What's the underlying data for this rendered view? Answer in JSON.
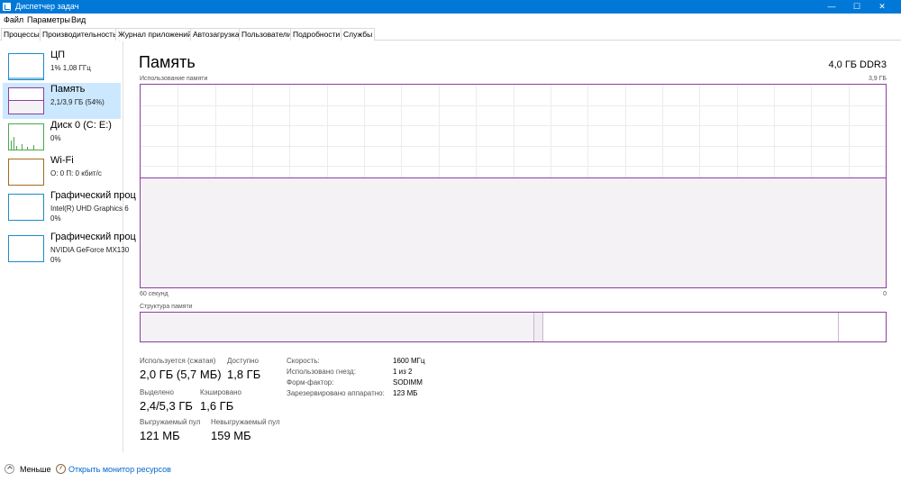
{
  "window": {
    "title": "Диспетчер задач",
    "min_glyph": "—",
    "max_glyph": "☐",
    "close_glyph": "✕"
  },
  "menu": [
    "Файл",
    "Параметры",
    "Вид"
  ],
  "tabs": [
    {
      "label": "Процессы",
      "active": false
    },
    {
      "label": "Производительность",
      "active": true
    },
    {
      "label": "Журнал приложений",
      "active": false
    },
    {
      "label": "Автозагрузка",
      "active": false
    },
    {
      "label": "Пользователи",
      "active": false
    },
    {
      "label": "Подробности",
      "active": false
    },
    {
      "label": "Службы",
      "active": false
    }
  ],
  "sidebar": {
    "items": [
      {
        "title": "ЦП",
        "lines": [
          "1%  1,08 ГГц"
        ],
        "active": false,
        "color": "#1e8cc8"
      },
      {
        "title": "Память",
        "lines": [
          "2,1/3,9 ГБ (54%)"
        ],
        "active": true,
        "color": "#8b3fa0"
      },
      {
        "title": "Диск 0 (C: E:)",
        "lines": [
          "0%"
        ],
        "active": false,
        "color": "#4ca64c"
      },
      {
        "title": "Wi-Fi",
        "lines": [
          "О: 0 П: 0 кбит/с"
        ],
        "active": false,
        "color": "#a66a1e"
      },
      {
        "title": "Графический проц",
        "lines": [
          "Intel(R) UHD Graphics 6",
          "0%"
        ],
        "active": false,
        "color": "#1e8cc8"
      },
      {
        "title": "Графический проц",
        "lines": [
          "NVIDIA GeForce MX130",
          "0%"
        ],
        "active": false,
        "color": "#1e8cc8"
      }
    ]
  },
  "memory": {
    "title": "Память",
    "spec": "4,0 ГБ DDR3",
    "graph": {
      "label": "Использование памяти",
      "max_label": "3,9 ГБ",
      "time_label": "60 секунд",
      "zero_label": "0",
      "usage_fraction": 0.54
    },
    "structure": {
      "label": "Структура памяти"
    },
    "stats": {
      "in_use_label": "Используется (сжатая)",
      "in_use_value": "2,0 ГБ (5,7 МБ)",
      "available_label": "Доступно",
      "available_value": "1,8 ГБ",
      "committed_label": "Выделено",
      "committed_value": "2,4/5,3 ГБ",
      "cached_label": "Кэшировано",
      "cached_value": "1,6 ГБ",
      "paged_label": "Выгружаемый пул",
      "paged_value": "121 МБ",
      "nonpaged_label": "Невыгружаемый пул",
      "nonpaged_value": "159 МБ"
    },
    "specs": [
      {
        "label": "Скорость:",
        "value": "1600 МГц"
      },
      {
        "label": "Использовано гнезд:",
        "value": "1 из 2"
      },
      {
        "label": "Форм-фактор:",
        "value": "SODIMM"
      },
      {
        "label": "Зарезервировано аппаратно:",
        "value": "123 МБ"
      }
    ]
  },
  "footer": {
    "fewer_label": "Меньше",
    "monitor_label": "Открыть монитор ресурсов"
  }
}
